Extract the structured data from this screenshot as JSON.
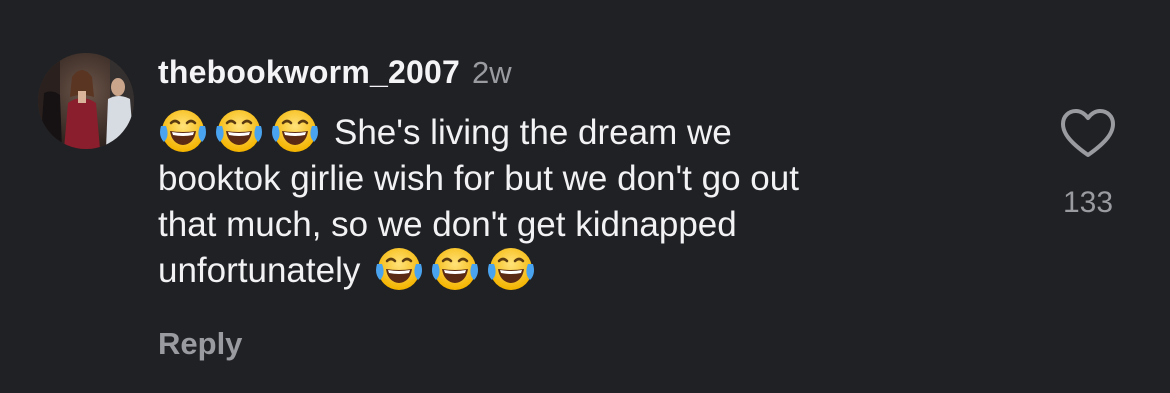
{
  "comment": {
    "username": "thebookworm_2007",
    "timestamp": "2w",
    "text_lines": [
      "She's living the dream we",
      "booktok girlie wish for but we don't go out",
      "that much, so we don't get kidnapped",
      "unfortunately"
    ],
    "lead_emoji_icon": "face-with-tears-of-joy-icon",
    "trail_emoji_icon": "face-with-tears-of-joy-icon",
    "reply_label": "Reply",
    "like_count": "133",
    "like_icon": "heart-outline-icon"
  },
  "colors": {
    "background": "#202125",
    "text_primary": "#f2f2f4",
    "text_secondary": "#9a9ba1"
  }
}
